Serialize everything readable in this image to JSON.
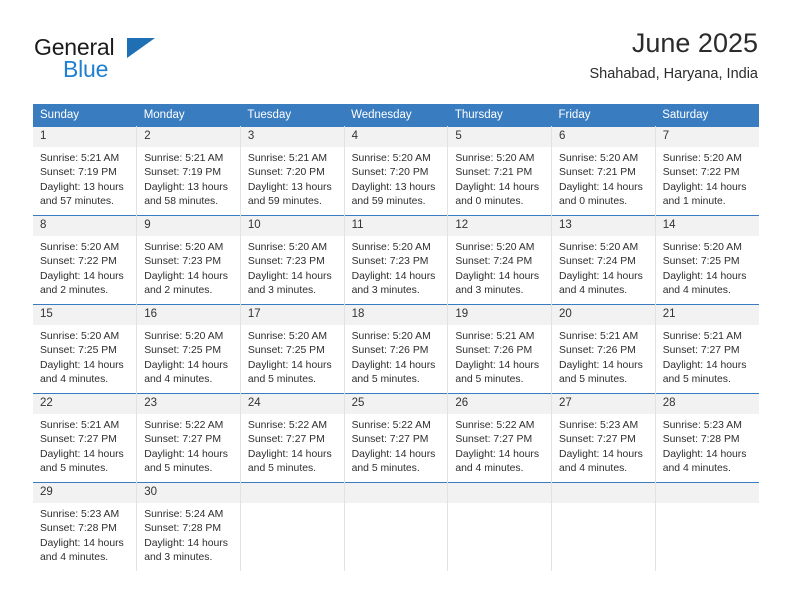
{
  "brand": {
    "name_top": "General",
    "name_bottom": "Blue",
    "accent_color": "#1f7fd0",
    "triangle_color": "#1f6fb5"
  },
  "header": {
    "title": "June 2025",
    "location": "Shahabad, Haryana, India"
  },
  "theme": {
    "header_bg": "#3a7cc0",
    "header_text": "#ffffff",
    "daynum_bg": "#f2f2f2",
    "cell_bg": "#ffffff",
    "grid_line": "#e2e2e2"
  },
  "weekday_headers": [
    "Sunday",
    "Monday",
    "Tuesday",
    "Wednesday",
    "Thursday",
    "Friday",
    "Saturday"
  ],
  "weeks": [
    [
      {
        "day": "1",
        "sunrise": "Sunrise: 5:21 AM",
        "sunset": "Sunset: 7:19 PM",
        "daylight": "Daylight: 13 hours and 57 minutes."
      },
      {
        "day": "2",
        "sunrise": "Sunrise: 5:21 AM",
        "sunset": "Sunset: 7:19 PM",
        "daylight": "Daylight: 13 hours and 58 minutes."
      },
      {
        "day": "3",
        "sunrise": "Sunrise: 5:21 AM",
        "sunset": "Sunset: 7:20 PM",
        "daylight": "Daylight: 13 hours and 59 minutes."
      },
      {
        "day": "4",
        "sunrise": "Sunrise: 5:20 AM",
        "sunset": "Sunset: 7:20 PM",
        "daylight": "Daylight: 13 hours and 59 minutes."
      },
      {
        "day": "5",
        "sunrise": "Sunrise: 5:20 AM",
        "sunset": "Sunset: 7:21 PM",
        "daylight": "Daylight: 14 hours and 0 minutes."
      },
      {
        "day": "6",
        "sunrise": "Sunrise: 5:20 AM",
        "sunset": "Sunset: 7:21 PM",
        "daylight": "Daylight: 14 hours and 0 minutes."
      },
      {
        "day": "7",
        "sunrise": "Sunrise: 5:20 AM",
        "sunset": "Sunset: 7:22 PM",
        "daylight": "Daylight: 14 hours and 1 minute."
      }
    ],
    [
      {
        "day": "8",
        "sunrise": "Sunrise: 5:20 AM",
        "sunset": "Sunset: 7:22 PM",
        "daylight": "Daylight: 14 hours and 2 minutes."
      },
      {
        "day": "9",
        "sunrise": "Sunrise: 5:20 AM",
        "sunset": "Sunset: 7:23 PM",
        "daylight": "Daylight: 14 hours and 2 minutes."
      },
      {
        "day": "10",
        "sunrise": "Sunrise: 5:20 AM",
        "sunset": "Sunset: 7:23 PM",
        "daylight": "Daylight: 14 hours and 3 minutes."
      },
      {
        "day": "11",
        "sunrise": "Sunrise: 5:20 AM",
        "sunset": "Sunset: 7:23 PM",
        "daylight": "Daylight: 14 hours and 3 minutes."
      },
      {
        "day": "12",
        "sunrise": "Sunrise: 5:20 AM",
        "sunset": "Sunset: 7:24 PM",
        "daylight": "Daylight: 14 hours and 3 minutes."
      },
      {
        "day": "13",
        "sunrise": "Sunrise: 5:20 AM",
        "sunset": "Sunset: 7:24 PM",
        "daylight": "Daylight: 14 hours and 4 minutes."
      },
      {
        "day": "14",
        "sunrise": "Sunrise: 5:20 AM",
        "sunset": "Sunset: 7:25 PM",
        "daylight": "Daylight: 14 hours and 4 minutes."
      }
    ],
    [
      {
        "day": "15",
        "sunrise": "Sunrise: 5:20 AM",
        "sunset": "Sunset: 7:25 PM",
        "daylight": "Daylight: 14 hours and 4 minutes."
      },
      {
        "day": "16",
        "sunrise": "Sunrise: 5:20 AM",
        "sunset": "Sunset: 7:25 PM",
        "daylight": "Daylight: 14 hours and 4 minutes."
      },
      {
        "day": "17",
        "sunrise": "Sunrise: 5:20 AM",
        "sunset": "Sunset: 7:25 PM",
        "daylight": "Daylight: 14 hours and 5 minutes."
      },
      {
        "day": "18",
        "sunrise": "Sunrise: 5:20 AM",
        "sunset": "Sunset: 7:26 PM",
        "daylight": "Daylight: 14 hours and 5 minutes."
      },
      {
        "day": "19",
        "sunrise": "Sunrise: 5:21 AM",
        "sunset": "Sunset: 7:26 PM",
        "daylight": "Daylight: 14 hours and 5 minutes."
      },
      {
        "day": "20",
        "sunrise": "Sunrise: 5:21 AM",
        "sunset": "Sunset: 7:26 PM",
        "daylight": "Daylight: 14 hours and 5 minutes."
      },
      {
        "day": "21",
        "sunrise": "Sunrise: 5:21 AM",
        "sunset": "Sunset: 7:27 PM",
        "daylight": "Daylight: 14 hours and 5 minutes."
      }
    ],
    [
      {
        "day": "22",
        "sunrise": "Sunrise: 5:21 AM",
        "sunset": "Sunset: 7:27 PM",
        "daylight": "Daylight: 14 hours and 5 minutes."
      },
      {
        "day": "23",
        "sunrise": "Sunrise: 5:22 AM",
        "sunset": "Sunset: 7:27 PM",
        "daylight": "Daylight: 14 hours and 5 minutes."
      },
      {
        "day": "24",
        "sunrise": "Sunrise: 5:22 AM",
        "sunset": "Sunset: 7:27 PM",
        "daylight": "Daylight: 14 hours and 5 minutes."
      },
      {
        "day": "25",
        "sunrise": "Sunrise: 5:22 AM",
        "sunset": "Sunset: 7:27 PM",
        "daylight": "Daylight: 14 hours and 5 minutes."
      },
      {
        "day": "26",
        "sunrise": "Sunrise: 5:22 AM",
        "sunset": "Sunset: 7:27 PM",
        "daylight": "Daylight: 14 hours and 4 minutes."
      },
      {
        "day": "27",
        "sunrise": "Sunrise: 5:23 AM",
        "sunset": "Sunset: 7:27 PM",
        "daylight": "Daylight: 14 hours and 4 minutes."
      },
      {
        "day": "28",
        "sunrise": "Sunrise: 5:23 AM",
        "sunset": "Sunset: 7:28 PM",
        "daylight": "Daylight: 14 hours and 4 minutes."
      }
    ],
    [
      {
        "day": "29",
        "sunrise": "Sunrise: 5:23 AM",
        "sunset": "Sunset: 7:28 PM",
        "daylight": "Daylight: 14 hours and 4 minutes."
      },
      {
        "day": "30",
        "sunrise": "Sunrise: 5:24 AM",
        "sunset": "Sunset: 7:28 PM",
        "daylight": "Daylight: 14 hours and 3 minutes."
      },
      {
        "day": "",
        "sunrise": "",
        "sunset": "",
        "daylight": ""
      },
      {
        "day": "",
        "sunrise": "",
        "sunset": "",
        "daylight": ""
      },
      {
        "day": "",
        "sunrise": "",
        "sunset": "",
        "daylight": ""
      },
      {
        "day": "",
        "sunrise": "",
        "sunset": "",
        "daylight": ""
      },
      {
        "day": "",
        "sunrise": "",
        "sunset": "",
        "daylight": ""
      }
    ]
  ]
}
